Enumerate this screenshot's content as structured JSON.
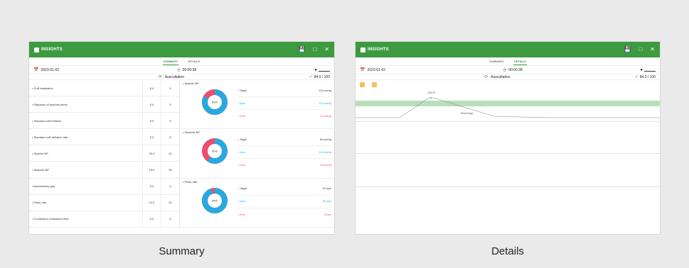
{
  "app": {
    "title": "INSIGHTS"
  },
  "tabs": [
    "SUMMARY",
    "DETAILS"
  ],
  "info": {
    "date": "2023-01-02",
    "time": "00:00:38",
    "mode": "Auscultation",
    "score": "84.0 / 100"
  },
  "summary": {
    "rows": [
      {
        "name": "• Cuff installation",
        "value": "5.0",
        "max": "5"
      },
      {
        "name": "• Palpation of brachial artery",
        "value": "5.0",
        "max": "5"
      },
      {
        "name": "• Standard cuff inflation",
        "value": "5.0",
        "max": "5"
      },
      {
        "name": "• Standard cuff deflation rate",
        "value": "5.0",
        "max": "5"
      },
      {
        "name": "• Systolic BP",
        "value": "20.0",
        "max": "20"
      },
      {
        "name": "• Diastolic BP",
        "value": "15.0",
        "max": "25"
      },
      {
        "name": "• Auscultatory gap",
        "value": "5.0",
        "max": "5"
      },
      {
        "name": "• Pulse rate",
        "value": "19.0",
        "max": "20"
      },
      {
        "name": "• Compliance evaluation time",
        "value": "5.0",
        "max": "5"
      }
    ],
    "charts": [
      {
        "title": "• Systolic BP",
        "percent": "83%",
        "fraction": 0.83,
        "target_label": "• Target",
        "target": "120 mmHg",
        "input_label": "• Input",
        "input": "120 mmHg",
        "error_label": "• Error",
        "error": "20 mmHg"
      },
      {
        "title": "• Diastolic BP",
        "percent": "60%",
        "fraction": 0.6,
        "target_label": "• Target",
        "target": "80 mmHg",
        "input_label": "• Input",
        "input": "110 mmHg",
        "error_label": "• Error",
        "error": "30 mmHg"
      },
      {
        "title": "• Pulse rate",
        "percent": "95%",
        "fraction": 0.95,
        "target_label": "• Target",
        "target": "90 bpm",
        "input_label": "• Input",
        "input": "85 bpm",
        "error_label": "• Error",
        "error": "5 bpm"
      }
    ]
  },
  "details": {
    "peak_label": "130/70",
    "curve_label": "80mmHg/s"
  },
  "captions": {
    "left": "Summary",
    "right": "Details"
  },
  "colors": {
    "brand": "#3c9a3f",
    "input": "#29a8e0",
    "error": "#ec4d6e"
  },
  "icons": {
    "app": "app-logo-icon",
    "save": "save-icon",
    "restore": "window-icon",
    "close": "close-icon",
    "calendar": "calendar-icon",
    "clock": "clock-icon",
    "user": "user-icon",
    "mode": "refresh-icon",
    "check": "check-icon"
  }
}
